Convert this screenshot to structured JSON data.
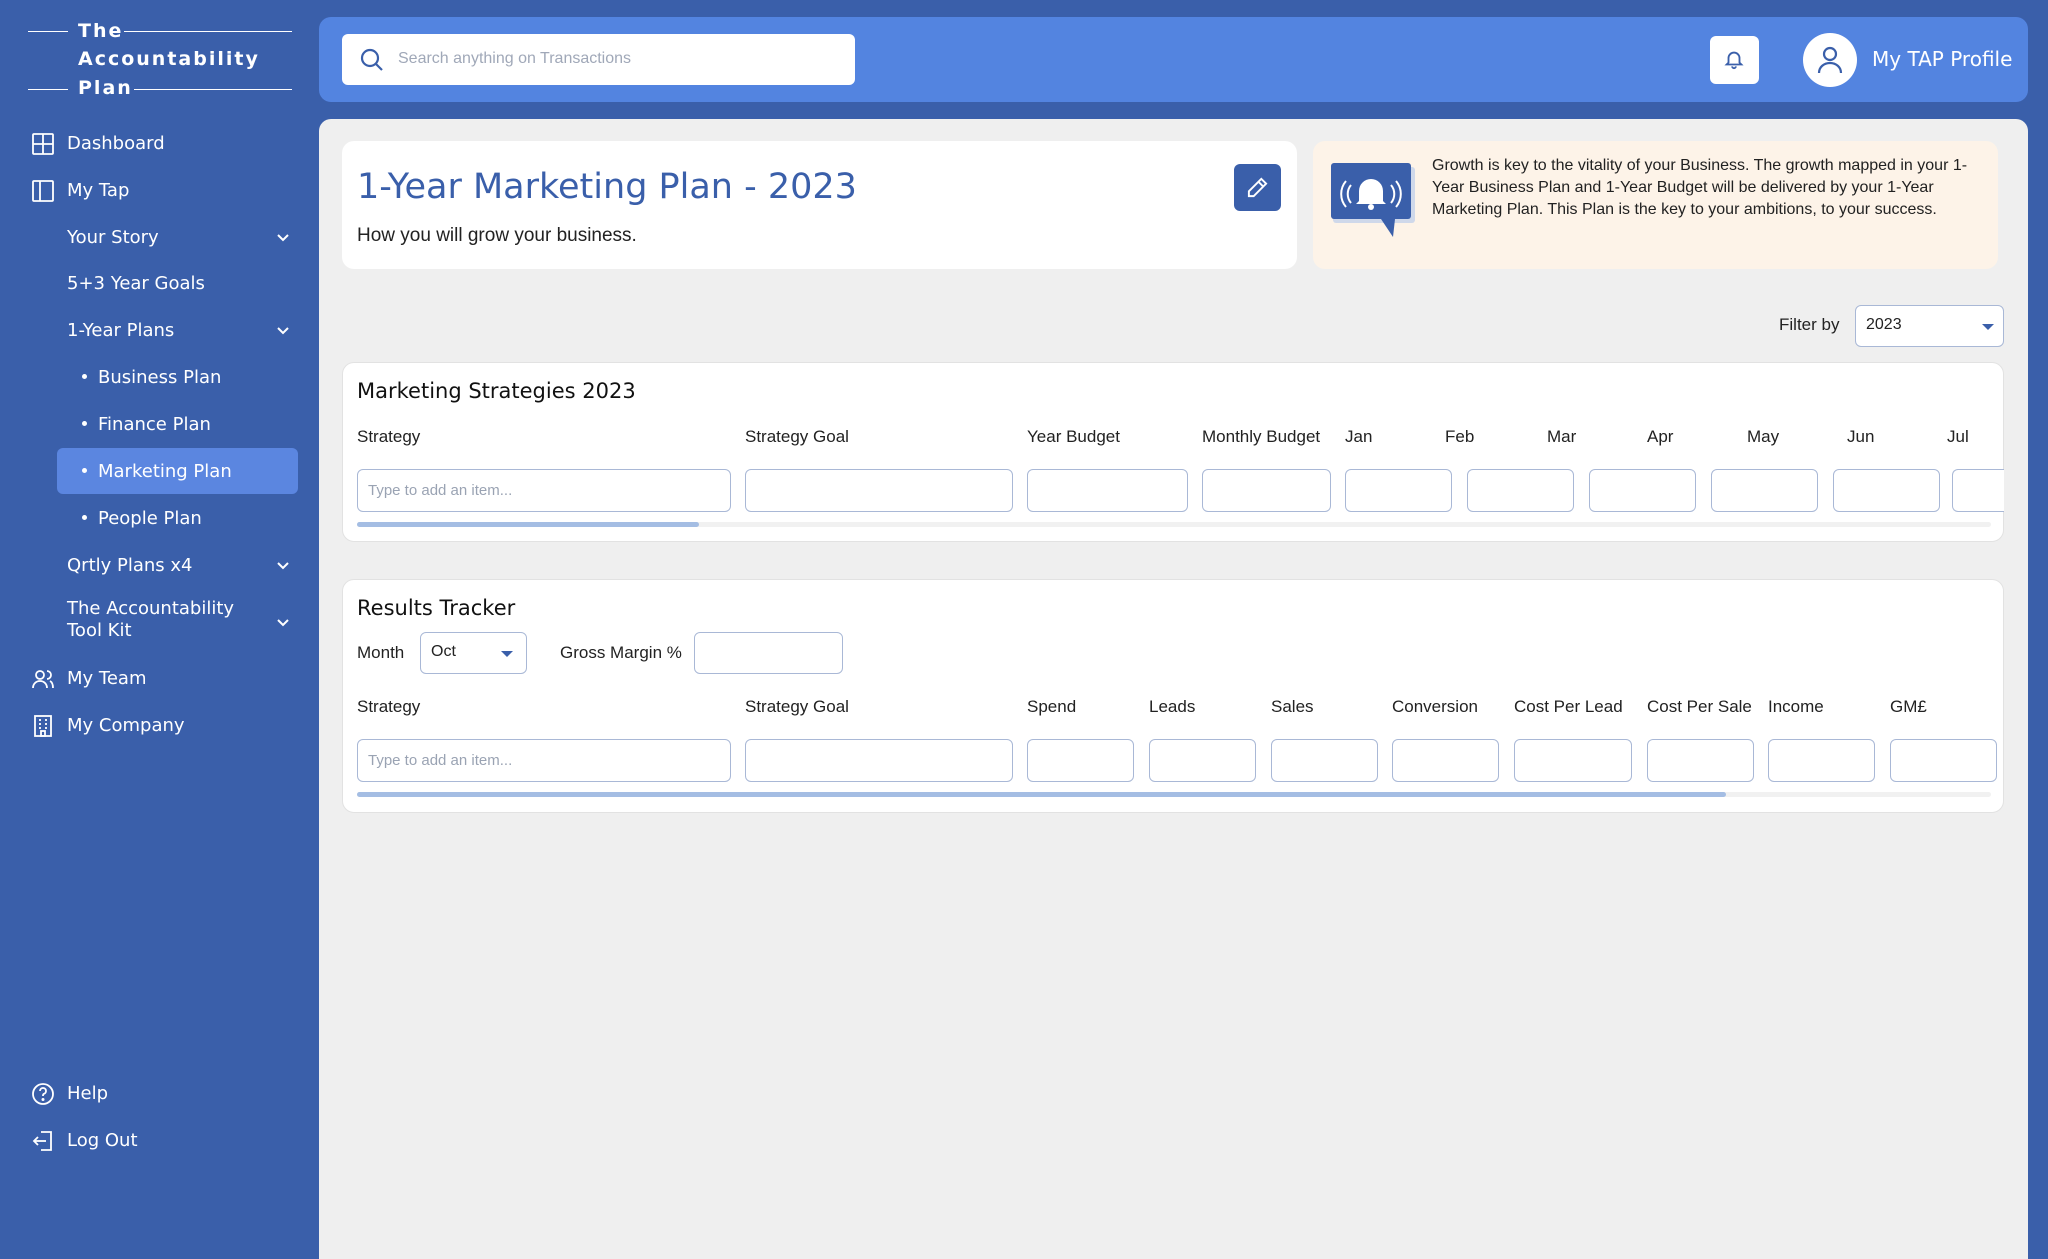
{
  "logo": {
    "line1": "The",
    "line2": "Accountability",
    "line3": "Plan"
  },
  "sidebar": {
    "dashboard": "Dashboard",
    "my_tap": "My Tap",
    "your_story": "Your Story",
    "goals": "5+3 Year Goals",
    "one_year_plans": "1-Year Plans",
    "business_plan": "Business Plan",
    "finance_plan": "Finance Plan",
    "marketing_plan": "Marketing Plan",
    "people_plan": "People Plan",
    "qrtly_plans": "Qrtly Plans x4",
    "toolkit_line1": "The Accountability",
    "toolkit_line2": "Tool Kit",
    "my_team": "My Team",
    "my_company": "My Company",
    "help": "Help",
    "log_out": "Log Out",
    "active_item": "Marketing Plan"
  },
  "header": {
    "search_placeholder": "Search anything on Transactions",
    "profile_label": "My TAP Profile"
  },
  "page": {
    "title": "1-Year Marketing Plan - 2023",
    "subtitle": "How you will grow your business.",
    "info_text": "Growth is key to the vitality of your Business. The growth mapped in your 1-Year Business Plan and 1-Year Budget will be delivered by your 1-Year Marketing Plan. This Plan is the key to your ambitions, to your success.",
    "filter_label": "Filter by",
    "filter_value": "2023"
  },
  "strategies": {
    "title": "Marketing Strategies 2023",
    "columns": [
      "Strategy",
      "Strategy Goal",
      "Year Budget",
      "Monthly Budget",
      "Jan",
      "Feb",
      "Mar",
      "Apr",
      "May",
      "Jun",
      "Jul"
    ],
    "input_placeholder": "Type to add an item...",
    "scroll_position": 0.2
  },
  "tracker": {
    "title": "Results Tracker",
    "month_label": "Month",
    "month_value": "Oct",
    "gross_margin_label": "Gross Margin %",
    "columns": [
      "Strategy",
      "Strategy Goal",
      "Spend",
      "Leads",
      "Sales",
      "Conversion",
      "Cost Per Lead",
      "Cost Per Sale",
      "Income",
      "GM£"
    ],
    "input_placeholder": "Type to add an item...",
    "scroll_position": 0.84
  },
  "colors": {
    "primary": "#3a5faa",
    "topbar": "#5384e0",
    "active": "#5b86e0",
    "info_bg": "#fdf3e8"
  }
}
